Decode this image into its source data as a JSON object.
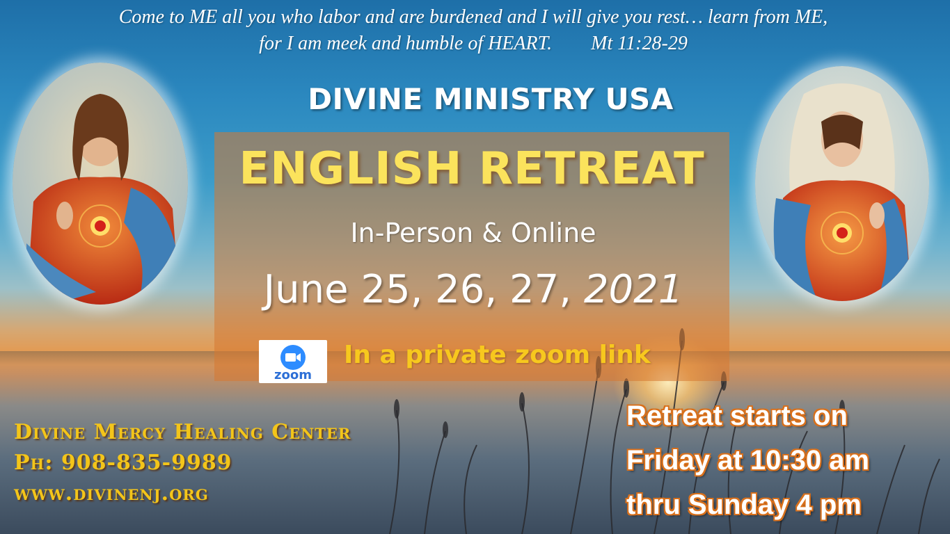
{
  "scripture": {
    "line1": "Come to ME all you who labor and are burdened and I will give you rest… learn from ME,",
    "line2": "for I am meek and humble of HEART.",
    "reference": "Mt 11:28-29"
  },
  "organization": "DIVINE MINISTRY USA",
  "event": {
    "title": "ENGLISH RETREAT",
    "mode": "In-Person & Online",
    "dates": "June 25, 26, 27, ",
    "year": "2021",
    "zoom_note": "In a private zoom link",
    "zoom_logo_text": "zoom"
  },
  "contact": {
    "center": "Divine Mercy Healing Center",
    "phone": "Ph:  908-835-9989",
    "website": "www.divinenj.org"
  },
  "schedule": {
    "line1": "Retreat starts on",
    "line2": "Friday at 10:30 am",
    "line3": "thru Sunday 4 pm"
  },
  "colors": {
    "accent_yellow": "#fbe35c",
    "contact_gold": "#f3c51a",
    "panel_orange": "#d67832",
    "zoom_blue": "#2d8cff"
  }
}
